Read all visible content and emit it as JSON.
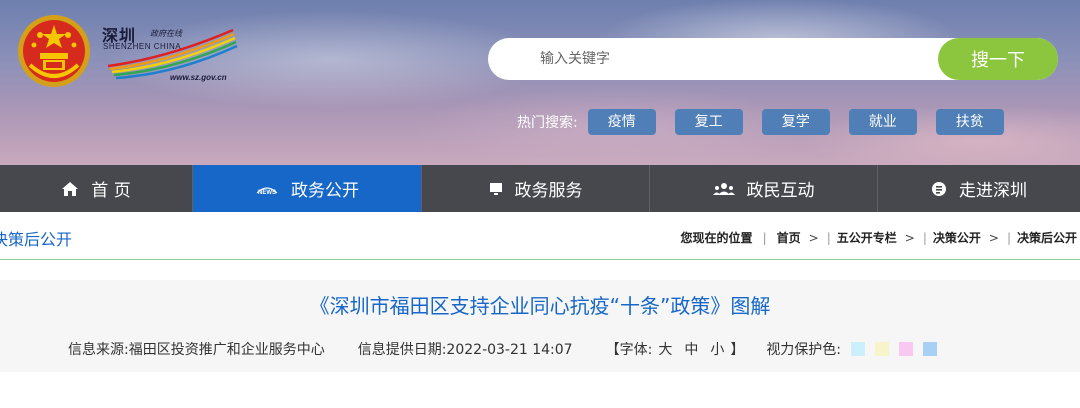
{
  "logo": {
    "calligraphy": "深圳",
    "small_text": "政府在线",
    "english": "SHENZHEN CHINA",
    "url": "www.sz.gov.cn",
    "emblem_icon": "national-emblem-icon"
  },
  "search": {
    "placeholder": "输入关键字",
    "button_label": "搜一下"
  },
  "hot_search": {
    "label": "热门搜索:",
    "tags": [
      "疫情",
      "复工",
      "复学",
      "就业",
      "扶贫"
    ]
  },
  "nav": {
    "items": [
      {
        "label": "首 页",
        "icon": "home-icon",
        "active": false
      },
      {
        "label": "政务公开",
        "icon": "news-icon",
        "active": true
      },
      {
        "label": "政务服务",
        "icon": "monitor-icon",
        "active": false
      },
      {
        "label": "政民互动",
        "icon": "people-icon",
        "active": false
      },
      {
        "label": "走进深圳",
        "icon": "info-circle-icon",
        "active": false
      }
    ]
  },
  "breadcrumb": {
    "section_title": "决策后公开",
    "location_label": "您现在的位置",
    "items": [
      "首页",
      "五公开专栏",
      "决策公开",
      "决策后公开"
    ]
  },
  "article": {
    "title": "《深圳市福田区支持企业同心抗疫“十条”政策》图解",
    "source_label": "信息来源:福田区投资推广和企业服务中心",
    "date_label": "信息提供日期:2022-03-21 14:07",
    "font_label_open": "【字体:",
    "font_sizes": [
      "大",
      "中",
      "小"
    ],
    "font_label_close": "】",
    "eye_care_label": "视力保护色:",
    "eye_care_colors": [
      "#ccf0fb",
      "#f6f4c8",
      "#f8c8f0",
      "#a8d0f4"
    ]
  },
  "colors": {
    "accent_blue": "#1767c8",
    "search_green": "#8cc63e",
    "nav_dark": "#46484e",
    "tag_blue": "#4f7fb6"
  }
}
